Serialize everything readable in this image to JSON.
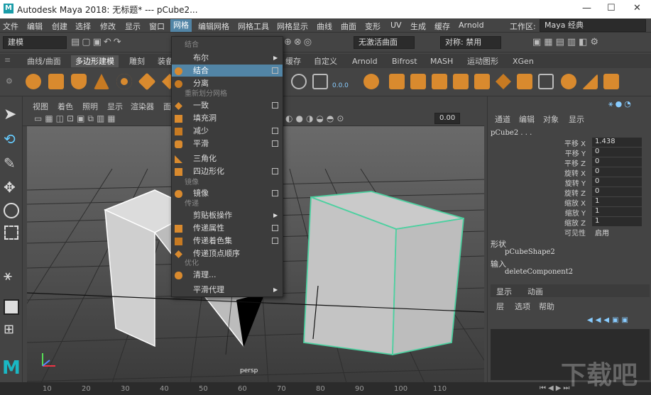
{
  "title_bar": {
    "app_title": "Autodesk Maya 2018: 无标题*   ---   pCube2...",
    "minimize": "—",
    "maximize": "☐",
    "close": "✕"
  },
  "menubar": {
    "items": [
      "文件",
      "编辑",
      "创建",
      "选择",
      "修改",
      "显示",
      "窗口",
      "网格",
      "编辑网格",
      "网格工具",
      "网格显示",
      "曲线",
      "曲面",
      "变形",
      "UV",
      "生成",
      "缓存",
      "Arnold"
    ],
    "workspace_label": "工作区:",
    "workspace_value": "Maya 经典"
  },
  "statusline": {
    "mode": "建模",
    "no_live_surface": "无激活曲面",
    "symmetry": "对称: 禁用"
  },
  "shelf_tabs": [
    "曲线/曲面",
    "多边形建模",
    "雕刻",
    "装备",
    "缓存",
    "自定义",
    "Arnold",
    "Bifrost",
    "MASH",
    "运动图形",
    "XGen"
  ],
  "viewport": {
    "menu": [
      "视图",
      "着色",
      "照明",
      "显示",
      "渲染器",
      "面"
    ],
    "field_value": "0.00",
    "camera_label": "persp"
  },
  "mesh_menu": {
    "sections": {
      "combine": "结合",
      "remesh": "重新划分网格",
      "mirror": "镜像",
      "transfer": "传递",
      "optimize": "优化"
    },
    "items": {
      "boolean": "布尔",
      "combine": "结合",
      "separate": "分离",
      "conform": "一致",
      "fill_hole": "填充洞",
      "reduce": "减少",
      "smooth": "平滑",
      "triangulate": "三角化",
      "quadrangulate": "四边形化",
      "mirror": "镜像",
      "clipboard": "剪贴板操作",
      "transfer_attributes": "传递属性",
      "transfer_shading": "传递着色集",
      "transfer_vertex_order": "传递顶点顺序",
      "cleanup": "清理...",
      "smooth_proxy": "平滑代理"
    }
  },
  "channel_box": {
    "menu": [
      "通道",
      "编辑",
      "对象",
      "显示"
    ],
    "object": "pCube2 . . .",
    "attributes": [
      {
        "label": "平移 X",
        "value": "1.438"
      },
      {
        "label": "平移 Y",
        "value": "0"
      },
      {
        "label": "平移 Z",
        "value": "0"
      },
      {
        "label": "旋转 X",
        "value": "0"
      },
      {
        "label": "旋转 Y",
        "value": "0"
      },
      {
        "label": "旋转 Z",
        "value": "0"
      },
      {
        "label": "缩放 X",
        "value": "1"
      },
      {
        "label": "缩放 Y",
        "value": "1"
      },
      {
        "label": "缩放 Z",
        "value": "1"
      },
      {
        "label": "可见性",
        "value": "启用"
      }
    ],
    "shapes_label": "形状",
    "shape_name": "pCubeShape2",
    "inputs_label": "输入",
    "input_name": "deleteComponent2"
  },
  "layer_editor": {
    "tabs": [
      "显示",
      "动画"
    ],
    "menu": [
      "层",
      "选项",
      "帮助"
    ]
  },
  "timeline": {
    "ticks": [
      "10",
      "20",
      "30",
      "40",
      "50",
      "60",
      "70",
      "80",
      "90",
      "100",
      "110"
    ]
  },
  "watermark": "下载吧",
  "colors": {
    "highlight": "#5285a6",
    "selected_cube": "#4dd0a0",
    "brand": "#1a9ca8"
  }
}
